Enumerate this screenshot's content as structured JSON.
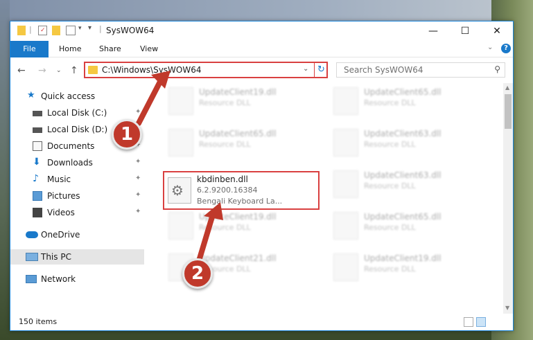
{
  "window": {
    "title": "SysWOW64",
    "minimize": "—",
    "maximize": "☐",
    "close": "✕"
  },
  "ribbon": {
    "file": "File",
    "home": "Home",
    "share": "Share",
    "view": "View",
    "help": "?"
  },
  "address": {
    "path": "C:\\Windows\\SysWOW64",
    "search_placeholder": "Search SysWOW64"
  },
  "nav": {
    "items": [
      {
        "label": "Quick access",
        "icon": "star-icon"
      },
      {
        "label": "Local Disk (C:)",
        "icon": "drive-icon"
      },
      {
        "label": "Local Disk (D:)",
        "icon": "drive-icon"
      },
      {
        "label": "Documents",
        "icon": "documents-icon"
      },
      {
        "label": "Downloads",
        "icon": "downloads-icon"
      },
      {
        "label": "Music",
        "icon": "music-icon"
      },
      {
        "label": "Pictures",
        "icon": "pictures-icon"
      },
      {
        "label": "Videos",
        "icon": "videos-icon"
      },
      {
        "label": "OneDrive",
        "icon": "cloud-icon"
      },
      {
        "label": "This PC",
        "icon": "computer-icon"
      },
      {
        "label": "Network",
        "icon": "network-icon"
      }
    ]
  },
  "files": {
    "blurred": [
      {
        "name": "UpdateClient19.dll",
        "desc": "Resource DLL"
      },
      {
        "name": "UpdateClient65.dll",
        "desc": "Resource DLL"
      },
      {
        "name": "UpdateClient65.dll",
        "desc": "Resource DLL"
      },
      {
        "name": "UpdateClient63.dll",
        "desc": "Resource DLL"
      },
      {
        "name": "UpdateClient63.dll",
        "desc": "Resource DLL"
      },
      {
        "name": "UpdateClient19.dll",
        "desc": "Resource DLL"
      },
      {
        "name": "UpdateClient65.dll",
        "desc": "Resource DLL"
      },
      {
        "name": "UpdateClient21.dll",
        "desc": "Resource DLL"
      },
      {
        "name": "UpdateClient19.dll",
        "desc": "Resource DLL"
      }
    ],
    "highlighted": {
      "name": "kbdinben.dll",
      "version": "6.2.9200.16384",
      "desc": "Bengali Keyboard La..."
    }
  },
  "status": {
    "items": "150 items"
  },
  "annotations": {
    "badge1": "1",
    "badge2": "2",
    "color": "#c0392b"
  }
}
